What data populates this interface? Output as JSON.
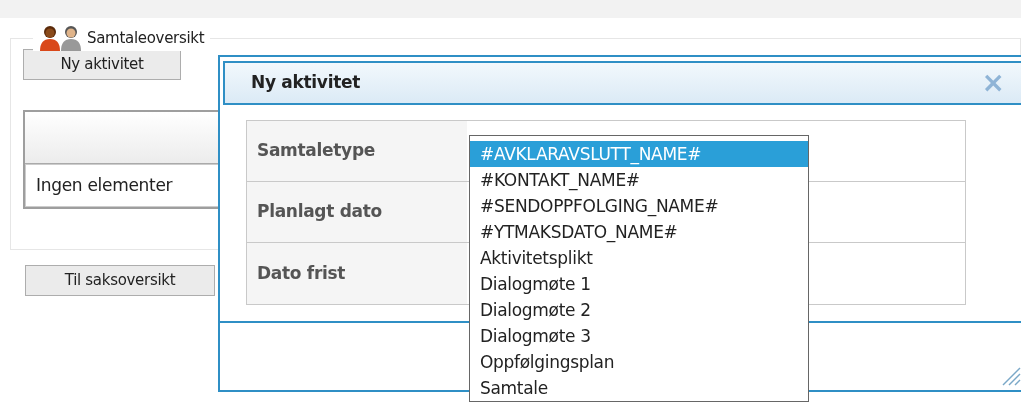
{
  "section": {
    "title": "Samtaleoversikt",
    "new_button": "Ny aktivitet",
    "table": {
      "empty_text": "Ingen elementer"
    },
    "back_button": "Til saksoversikt"
  },
  "dialog": {
    "title": "Ny aktivitet",
    "close": "×",
    "fields": [
      {
        "label": "Samtaletype"
      },
      {
        "label": "Planlagt dato"
      },
      {
        "label": "Dato frist"
      }
    ],
    "dropdown": [
      {
        "label": "#AVKLARAVSLUTT_NAME#",
        "selected": true
      },
      {
        "label": "#KONTAKT_NAME#",
        "selected": false
      },
      {
        "label": "#SENDOPPFOLGING_NAME#",
        "selected": false
      },
      {
        "label": "#YTMAKSDATO_NAME#",
        "selected": false
      },
      {
        "label": "Aktivitetsplikt",
        "selected": false
      },
      {
        "label": "Dialogmøte 1",
        "selected": false
      },
      {
        "label": "Dialogmøte 2",
        "selected": false
      },
      {
        "label": "Dialogmøte 3",
        "selected": false
      },
      {
        "label": "Oppfølgingsplan",
        "selected": false
      },
      {
        "label": "Samtale",
        "selected": false
      }
    ]
  }
}
